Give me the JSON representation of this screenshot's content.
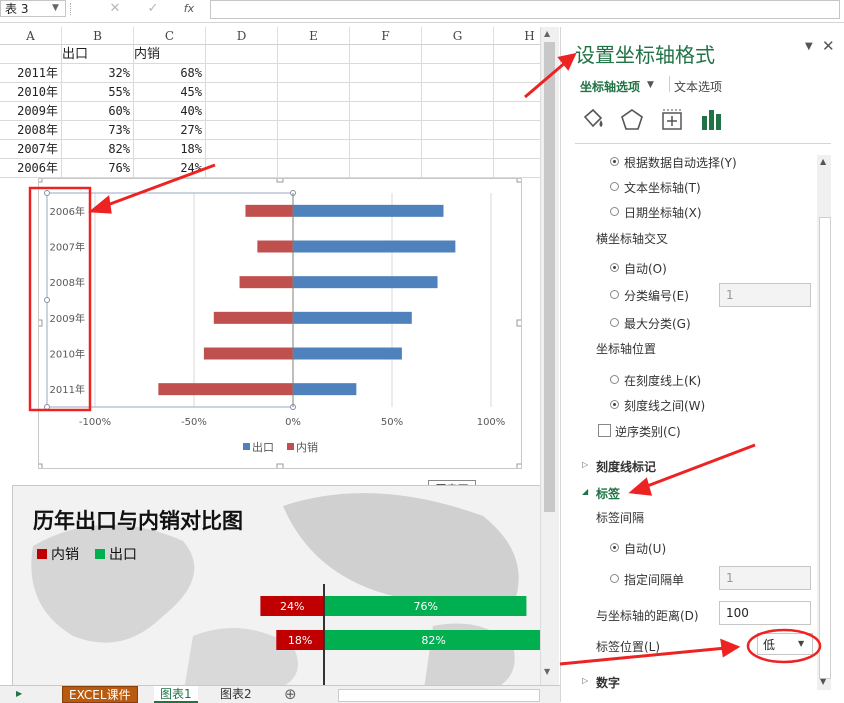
{
  "formula_bar": {
    "name_box": "表 3",
    "cancel_symbol": "✕",
    "confirm_symbol": "✓",
    "fx_symbol": "fx",
    "input_value": ""
  },
  "sheet": {
    "columns": [
      "A",
      "B",
      "C",
      "D",
      "E",
      "F",
      "G",
      "H"
    ],
    "header_row": {
      "b": "出口",
      "c": "内销"
    },
    "rows": [
      {
        "year": "2011年",
        "export": "32%",
        "domestic": "68%"
      },
      {
        "year": "2010年",
        "export": "55%",
        "domestic": "45%"
      },
      {
        "year": "2009年",
        "export": "60%",
        "domestic": "40%"
      },
      {
        "year": "2008年",
        "export": "73%",
        "domestic": "27%"
      },
      {
        "year": "2007年",
        "export": "82%",
        "domestic": "18%"
      },
      {
        "year": "2006年",
        "export": "76%",
        "domestic": "24%"
      }
    ],
    "tabs": [
      "EXCEL课件",
      "图表1",
      "图表2"
    ],
    "add_sheet_symbol": "⊕"
  },
  "chart_area_tooltip": "图表区",
  "chart_data": [
    {
      "type": "bar",
      "orientation": "horizontal",
      "categories": [
        "2006年",
        "2007年",
        "2008年",
        "2009年",
        "2010年",
        "2011年"
      ],
      "series": [
        {
          "name": "出口",
          "color": "#4f81bd",
          "values": [
            76,
            82,
            73,
            60,
            55,
            32
          ]
        },
        {
          "name": "内销",
          "color": "#c0504d",
          "values": [
            -24,
            -18,
            -27,
            -40,
            -45,
            -68
          ]
        }
      ],
      "xticks": [
        "-100%",
        "-50%",
        "0%",
        "50%",
        "100%"
      ],
      "xlim": [
        -100,
        100
      ],
      "grid": true,
      "legend": "bottom"
    },
    {
      "type": "bar",
      "orientation": "horizontal",
      "title": "历年出口与内销对比图",
      "legend_labels": [
        "内销",
        "出口"
      ],
      "colors": {
        "domestic": "#c00000",
        "export": "#00b050"
      },
      "rows": [
        {
          "domestic_label": "24%",
          "export_label": "76%",
          "domestic": 24,
          "export": 76
        },
        {
          "domestic_label": "18%",
          "export_label": "82%",
          "domestic": 18,
          "export": 82
        }
      ]
    }
  ],
  "pane": {
    "title": "设置坐标轴格式",
    "tab_axis_options": "坐标轴选项",
    "tab_text_options": "文本选项",
    "icons": [
      "fill-icon",
      "shape-pentagon-icon",
      "size-properties-icon",
      "bar-chart-icon"
    ],
    "axis_type": {
      "options": [
        "根据数据自动选择(Y)",
        "文本坐标轴(T)",
        "日期坐标轴(X)"
      ],
      "selected": 0
    },
    "cross_heading": "横坐标轴交叉",
    "cross": {
      "options": [
        "自动(O)",
        "分类编号(E)",
        "最大分类(G)"
      ],
      "selected": 0,
      "category_number": "1"
    },
    "position_heading": "坐标轴位置",
    "position": {
      "options": [
        "在刻度线上(K)",
        "刻度线之间(W)"
      ],
      "selected": 1
    },
    "reverse_label": "逆序类别(C)",
    "tick_marks_section": "刻度线标记",
    "labels_section": "标签",
    "label_interval_heading": "标签间隔",
    "label_interval": {
      "options": [
        "自动(U)",
        "指定间隔单"
      ],
      "selected": 0,
      "value": "1"
    },
    "distance_label": "与坐标轴的距离(D)",
    "distance_value": "100",
    "label_position_label": "标签位置(L)",
    "label_position_value": "低",
    "number_section": "数字"
  },
  "annotation_color": "#ee2222"
}
